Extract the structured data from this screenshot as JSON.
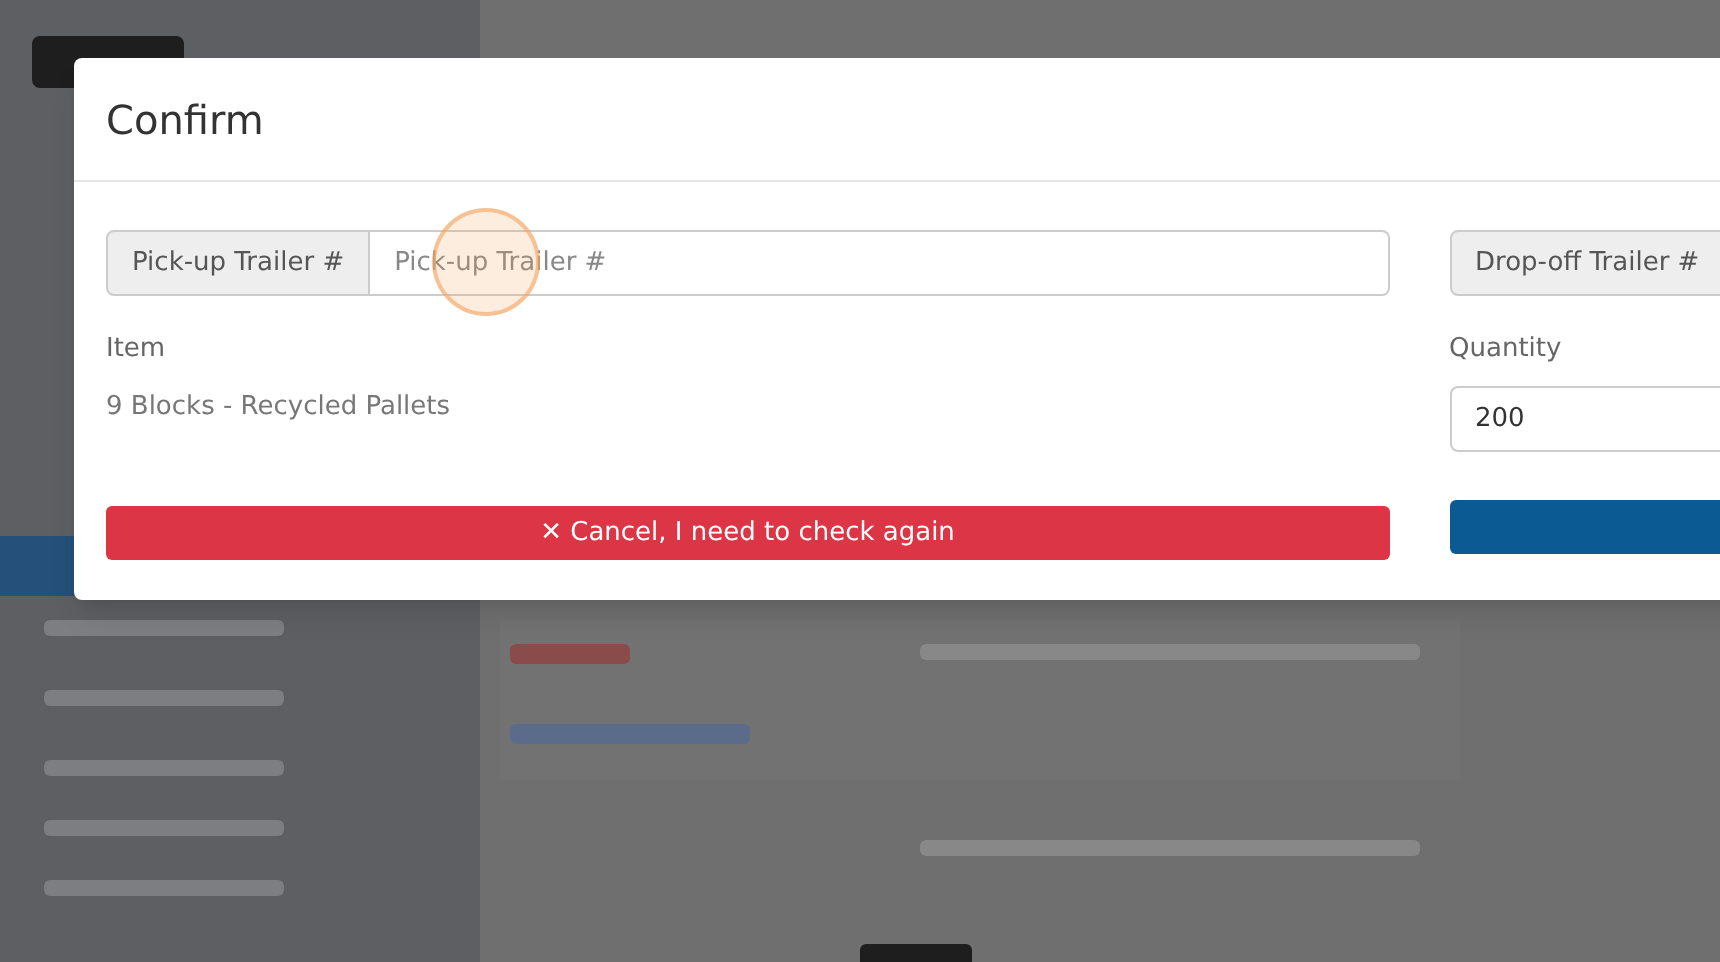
{
  "dialog": {
    "title": "Confirm",
    "pickup_trailer": {
      "label": "Pick-up Trailer #",
      "placeholder": "Pick-up Trailer #"
    },
    "dropoff_trailer": {
      "label": "Drop-off Trailer #"
    },
    "item": {
      "label": "Item",
      "value": "9 Blocks - Recycled Pallets"
    },
    "quantity": {
      "label": "Quantity",
      "value": "200"
    },
    "cancel_button": "✕ Cancel, I need to check again"
  }
}
